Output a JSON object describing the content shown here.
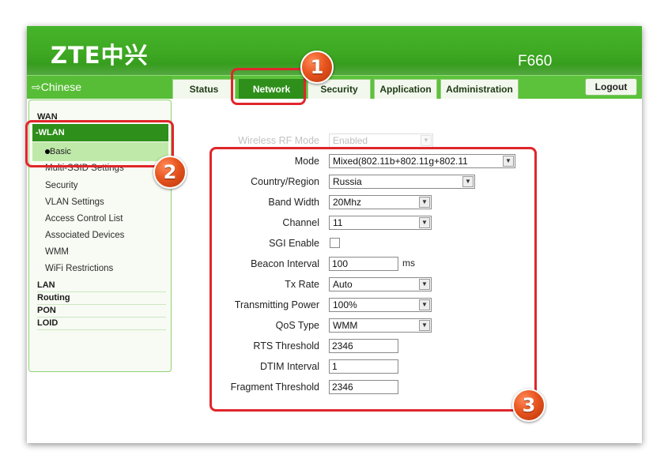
{
  "header": {
    "logo": "ZTE中兴",
    "model": "F660"
  },
  "nav": {
    "language": "⇨Chinese",
    "tabs": [
      "Status",
      "Network",
      "Security",
      "Application",
      "Administration"
    ],
    "active_tab": "Network",
    "logout": "Logout"
  },
  "sidebar": {
    "wan": "WAN",
    "wlan": "-WLAN",
    "basic": "Basic",
    "wlan_items": [
      "Multi-SSID Settings",
      "Security",
      "VLAN Settings",
      "Access Control List",
      "Associated Devices",
      "WMM",
      "WiFi Restrictions"
    ],
    "categories": [
      "LAN",
      "Routing",
      "PON",
      "LOID"
    ]
  },
  "form": {
    "rf_mode": {
      "label": "Wireless RF Mode",
      "value": "Enabled"
    },
    "mode": {
      "label": "Mode",
      "value": "Mixed(802.11b+802.11g+802.11"
    },
    "country": {
      "label": "Country/Region",
      "value": "Russia"
    },
    "bandwidth": {
      "label": "Band Width",
      "value": "20Mhz"
    },
    "channel": {
      "label": "Channel",
      "value": "11"
    },
    "sgi": {
      "label": "SGI Enable",
      "checked": false
    },
    "beacon": {
      "label": "Beacon Interval",
      "value": "100",
      "unit": "ms"
    },
    "txrate": {
      "label": "Tx Rate",
      "value": "Auto"
    },
    "txpower": {
      "label": "Transmitting Power",
      "value": "100%"
    },
    "qos": {
      "label": "QoS Type",
      "value": "WMM"
    },
    "rts": {
      "label": "RTS Threshold",
      "value": "2346"
    },
    "dtim": {
      "label": "DTIM Interval",
      "value": "1"
    },
    "fragment": {
      "label": "Fragment Threshold",
      "value": "2346"
    }
  },
  "annotations": [
    "1",
    "2",
    "3"
  ],
  "colors": {
    "brand_green": "#3ea823",
    "active_tab": "#2e8f1a",
    "highlight_red": "#e0262b",
    "badge_orange": "#e8541e"
  }
}
